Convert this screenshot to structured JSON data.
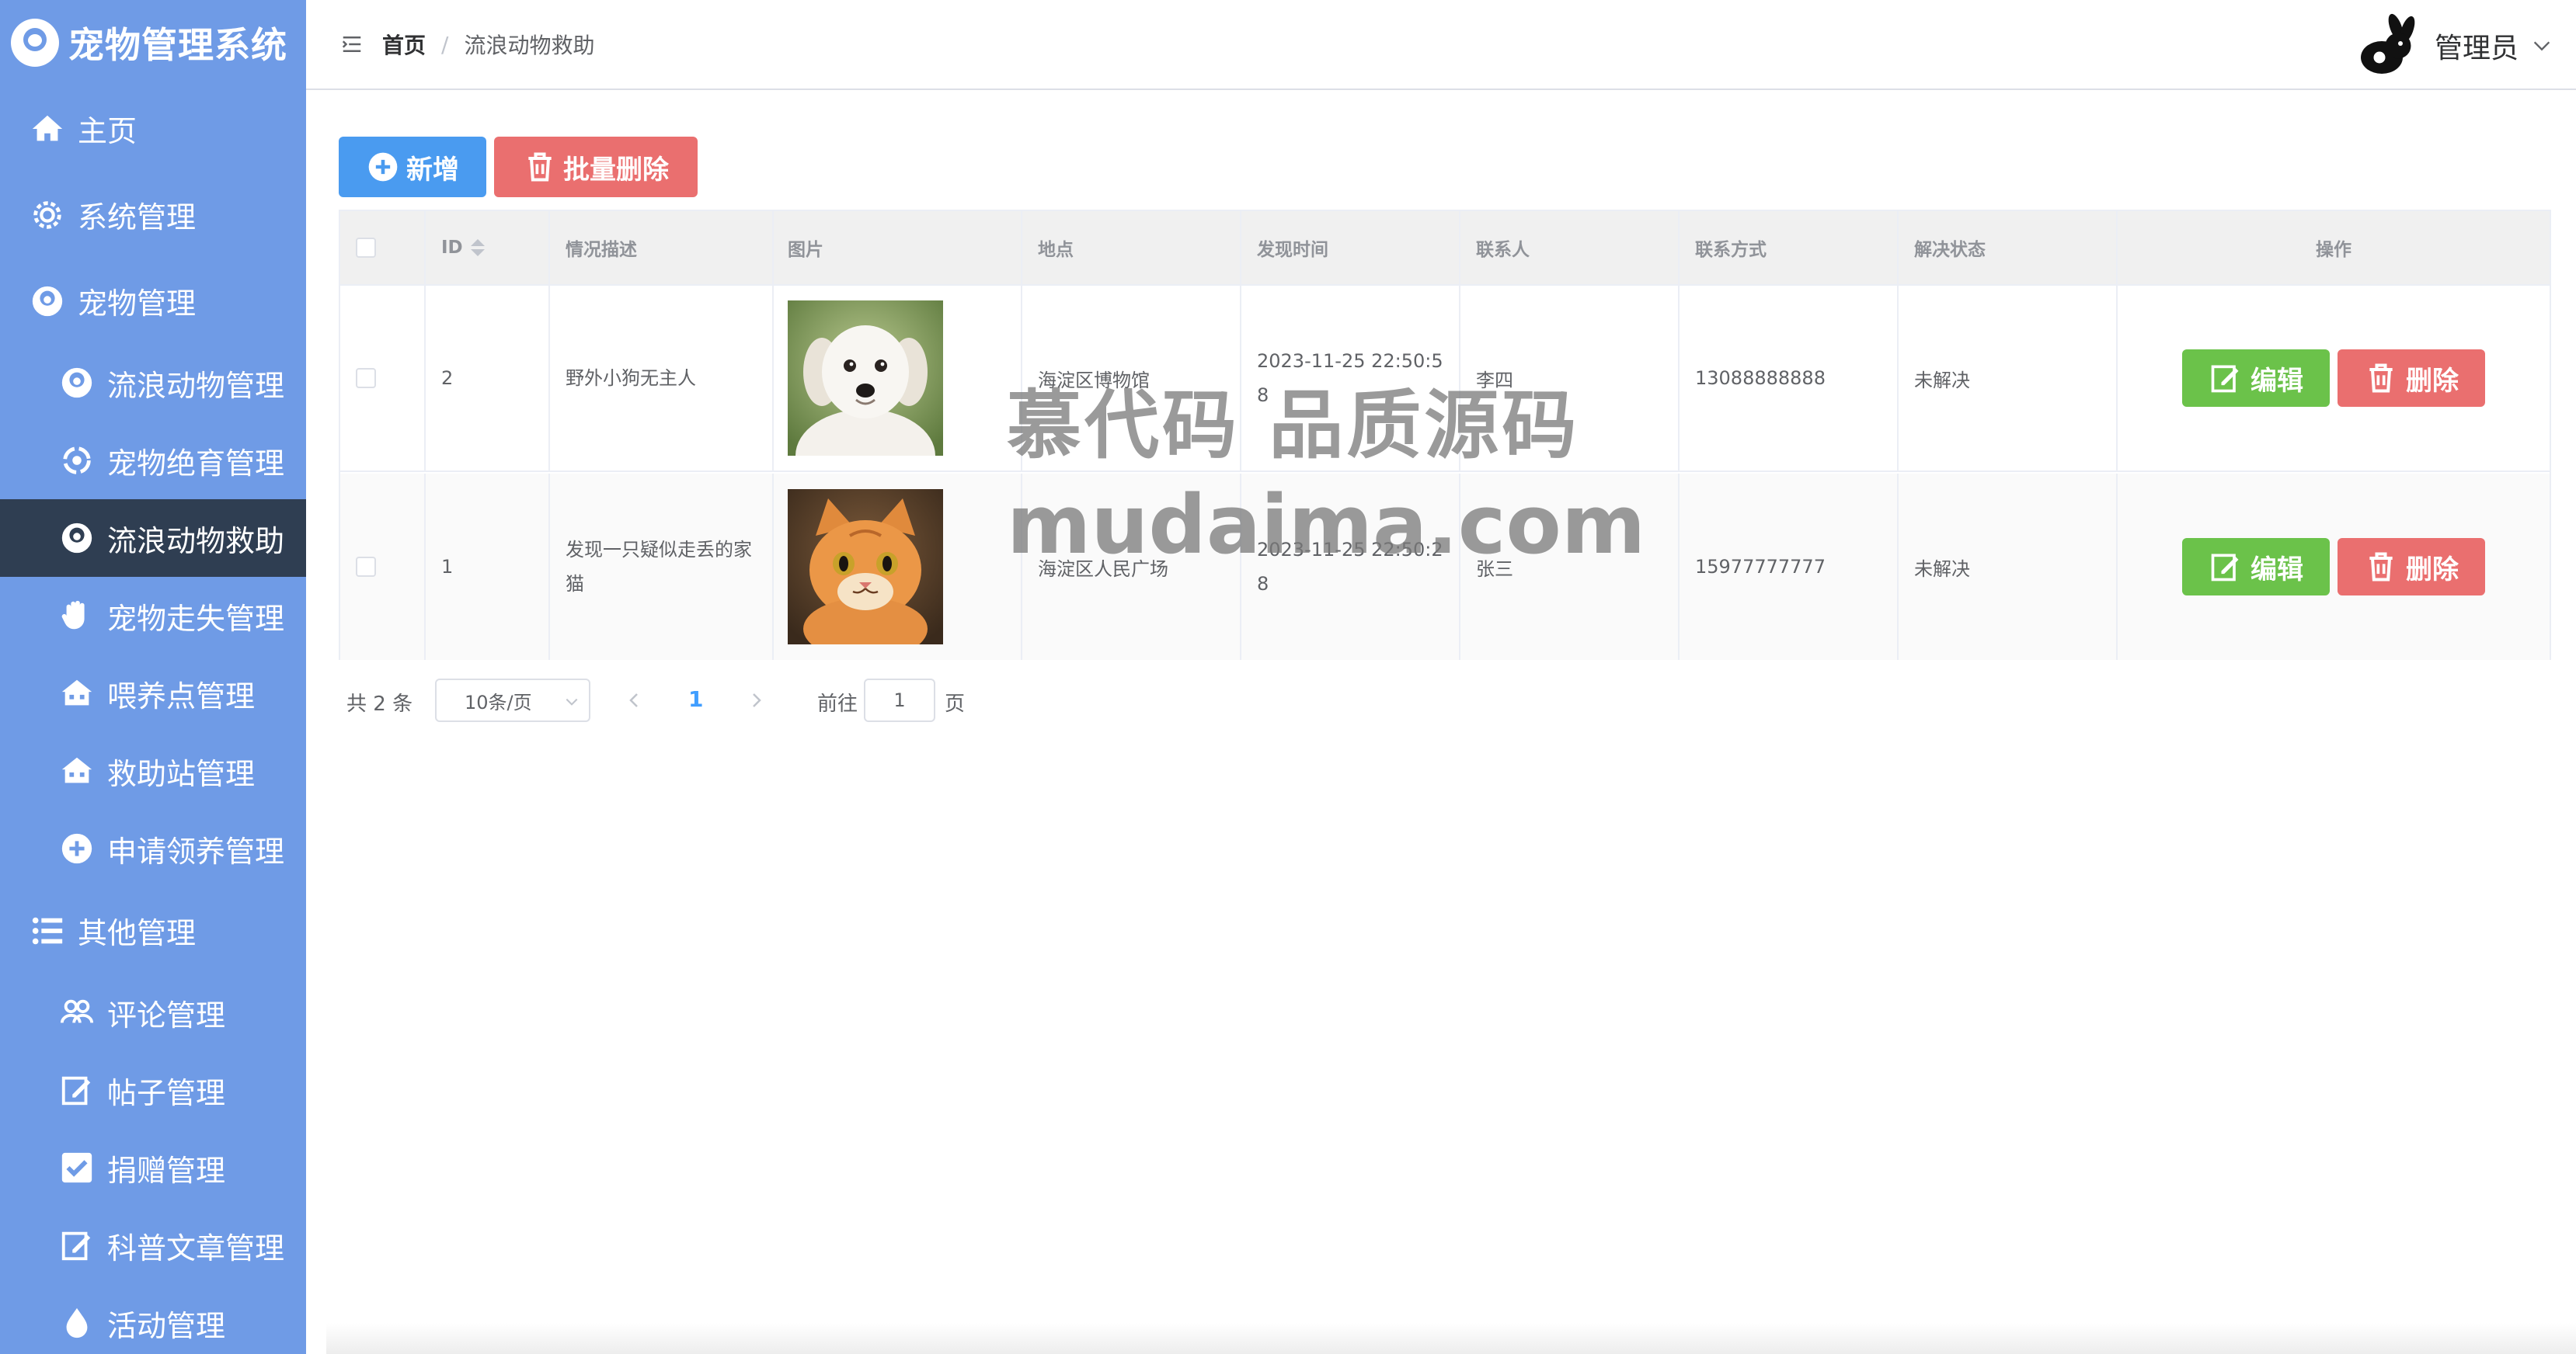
{
  "app": {
    "title": "宠物管理系统"
  },
  "sidebar": {
    "items": [
      {
        "label": "主页",
        "icon": "home-icon",
        "level": "top"
      },
      {
        "label": "系统管理",
        "icon": "gear-icon",
        "level": "top"
      },
      {
        "label": "宠物管理",
        "icon": "pet-icon",
        "level": "top"
      },
      {
        "label": "流浪动物管理",
        "icon": "pet-icon",
        "level": "sub"
      },
      {
        "label": "宠物绝育管理",
        "icon": "cycle-icon",
        "level": "sub"
      },
      {
        "label": "流浪动物救助",
        "icon": "pet-icon",
        "level": "sub",
        "active": true
      },
      {
        "label": "宠物走失管理",
        "icon": "hand-icon",
        "level": "sub"
      },
      {
        "label": "喂养点管理",
        "icon": "house-icon",
        "level": "sub"
      },
      {
        "label": "救助站管理",
        "icon": "house-icon",
        "level": "sub"
      },
      {
        "label": "申请领养管理",
        "icon": "plus-circle-icon",
        "level": "sub"
      },
      {
        "label": "其他管理",
        "icon": "list-icon",
        "level": "top"
      },
      {
        "label": "评论管理",
        "icon": "users-icon",
        "level": "sub"
      },
      {
        "label": "帖子管理",
        "icon": "edit-icon",
        "level": "sub"
      },
      {
        "label": "捐赠管理",
        "icon": "check-icon",
        "level": "sub"
      },
      {
        "label": "科普文章管理",
        "icon": "edit-icon",
        "level": "sub"
      },
      {
        "label": "活动管理",
        "icon": "drop-icon",
        "level": "sub"
      }
    ]
  },
  "header": {
    "breadcrumb_home": "首页",
    "breadcrumb_sep": "/",
    "breadcrumb_current": "流浪动物救助",
    "user_name": "管理员"
  },
  "toolbar": {
    "add_label": "新增",
    "batch_delete_label": "批量删除"
  },
  "table": {
    "columns": [
      "ID",
      "情况描述",
      "图片",
      "地点",
      "发现时间",
      "联系人",
      "联系方式",
      "解决状态",
      "操作"
    ],
    "rows": [
      {
        "id": "2",
        "description": "野外小狗无主人",
        "image": "puppy",
        "location": "海淀区博物馆",
        "found_time": "2023-11-25 22:50:58",
        "contact": "李四",
        "phone": "13088888888",
        "status": "未解决"
      },
      {
        "id": "1",
        "description": "发现一只疑似走丢的家猫",
        "image": "cat",
        "location": "海淀区人民广场",
        "found_time": "2023-11-25 22:50:28",
        "contact": "张三",
        "phone": "15977777777",
        "status": "未解决"
      }
    ],
    "edit_label": "编辑",
    "delete_label": "删除"
  },
  "pagination": {
    "total_text": "共 2 条",
    "page_size": "10条/页",
    "current_page": "1",
    "goto_label": "前往",
    "goto_value": "1",
    "goto_unit": "页"
  },
  "watermark": {
    "line1": "慕代码 品质源码",
    "line2": "mudaima.com"
  },
  "colors": {
    "sidebar": "#6f9be6",
    "sidebar_active": "#2f3e52",
    "primary": "#4a9bf0",
    "danger": "#ea6f6f",
    "success": "#6bc24a",
    "link": "#409eff"
  }
}
